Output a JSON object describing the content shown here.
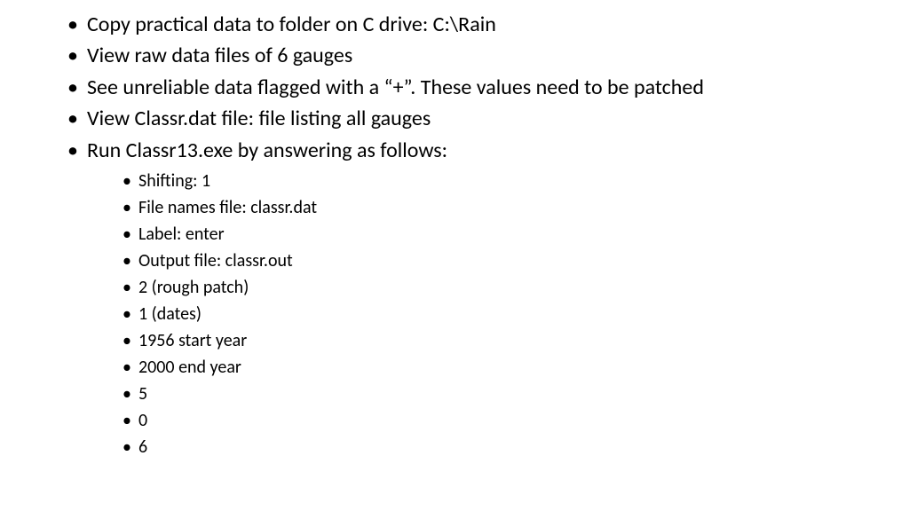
{
  "bullets": [
    {
      "text": "Copy practical data to folder on C drive: C:\\Rain"
    },
    {
      "text": "View raw data files of 6 gauges"
    },
    {
      "text": "See unreliable data flagged with a “+”. These values need to be patched"
    },
    {
      "text": "View Classr.dat file: file listing all gauges"
    },
    {
      "text": "Run Classr13.exe by answering as follows:",
      "sub": [
        "Shifting: 1",
        "File names file: classr.dat",
        "Label: enter",
        "Output file: classr.out",
        "2 (rough patch)",
        "1 (dates)",
        "1956 start year",
        "2000 end year",
        "5",
        "0",
        "6"
      ]
    }
  ]
}
